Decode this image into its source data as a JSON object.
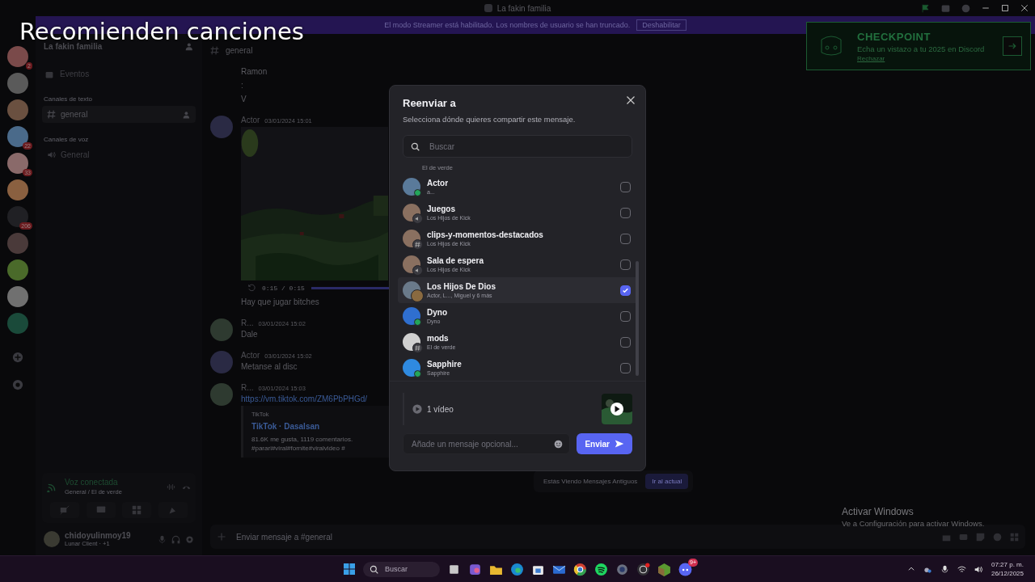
{
  "caption": "Recomienden canciones",
  "window": {
    "title": "La fakin familia"
  },
  "streamer_banner": {
    "text": "El modo Streamer está habilitado. Los nombres de usuario se han truncado.",
    "button": "Deshabilitar"
  },
  "servers": [
    {
      "color": "#7a4a4a",
      "badge": "2"
    },
    {
      "color": "#5a5a5a"
    },
    {
      "color": "#6a5040"
    },
    {
      "color": "#4a6a8a",
      "badge": "22"
    },
    {
      "color": "#8a6a6a",
      "badge": "33"
    },
    {
      "color": "#8a6040"
    },
    {
      "color": "#202024",
      "badge": "206"
    },
    {
      "color": "#4a3a3a"
    },
    {
      "color": "#4a6a2a"
    },
    {
      "color": "#707070"
    },
    {
      "color": "#1a4a3a"
    }
  ],
  "sidebar": {
    "server_name": "La fakin familia",
    "events": "Eventos",
    "categories": [
      {
        "label": "Canales de texto",
        "channels": [
          {
            "kind": "text",
            "name": "general",
            "selected": true
          }
        ]
      },
      {
        "label": "Canales de voz",
        "channels": [
          {
            "kind": "voice",
            "name": "General",
            "selected": false
          }
        ]
      }
    ],
    "voice_panel": {
      "status": "Voz conectada",
      "location": "General / El de verde"
    },
    "user": {
      "name": "chidoyulinmoy19",
      "activity": "Lunar Client · +1"
    }
  },
  "chat": {
    "channel": "general",
    "messages": [
      {
        "kind": "line",
        "text": "Ramon"
      },
      {
        "kind": "line",
        "text": ":"
      },
      {
        "kind": "line",
        "text": "V"
      },
      {
        "kind": "message",
        "author": "Actor",
        "time": "03/01/2024 15:01",
        "attachment": {
          "kind": "video",
          "time": "0:15 / 0:15",
          "level": 1
        }
      },
      {
        "kind": "line",
        "text": "Hay que jugar bitches"
      },
      {
        "kind": "message",
        "author": "R...",
        "time": "03/01/2024 15:02",
        "text": "Dale"
      },
      {
        "kind": "message",
        "author": "Actor",
        "time": "03/01/2024 15:02",
        "text": "Metanse al disc"
      },
      {
        "kind": "message",
        "author": "R...",
        "time": "03/01/2024 15:03",
        "link": "https://vm.tiktok.com/ZM6PbPHGd/",
        "embed": {
          "provider": "TikTok",
          "title": "TikTok · Dasalsan",
          "description": "81.6K me gusta, 1119 comentarios. #parari#viral#fornite#viralvideo #"
        }
      }
    ],
    "old_messages": {
      "text": "Estás Viendo Mensajes Antiguos",
      "button": "Ir al actual"
    },
    "input": {
      "placeholder": "Enviar mensaje a #general"
    }
  },
  "checkpoint": {
    "title": "CHECKPOINT",
    "text": "Echa un vistazo a tu 2025 en Discord",
    "dismiss": "Rechazar"
  },
  "dialog": {
    "title": "Reenviar a",
    "subtitle": "Selecciona dónde quieres compartir este mensaje.",
    "search": {
      "placeholder": "Buscar"
    },
    "clipped_row": {
      "subtitle": "El de verde"
    },
    "rows": [
      {
        "kind": "user",
        "name": "Actor",
        "subtitle": "a...",
        "color": "#5a7a9a",
        "checked": false
      },
      {
        "kind": "voice",
        "name": "Juegos",
        "subtitle": "Los Hijos de Kick",
        "color": "#8a7060",
        "checked": false
      },
      {
        "kind": "text",
        "name": "clips-y-momentos-destacados",
        "subtitle": "Los Hijos de Kick",
        "color": "#8a7060",
        "checked": false
      },
      {
        "kind": "voice",
        "name": "Sala de espera",
        "subtitle": "Los Hijos de Kick",
        "color": "#8a7060",
        "checked": false
      },
      {
        "kind": "group",
        "name": "Los Hijos De Dios",
        "subtitle": "Actor, L..., Miguel y 6 más",
        "color": "#6a7a8a",
        "checked": true
      },
      {
        "kind": "user",
        "name": "Dyno",
        "subtitle": "Dyno",
        "color": "#2f6fd0",
        "checked": false
      },
      {
        "kind": "text",
        "name": "mods",
        "subtitle": "El de verde",
        "color": "#d0d0d0",
        "checked": false
      },
      {
        "kind": "bot",
        "name": "Sapphire",
        "subtitle": "Sapphire",
        "color": "#2f8ae0",
        "checked": false
      }
    ],
    "attachment": "1 vídeo",
    "message": {
      "placeholder": "Añade un mensaje opcional..."
    },
    "send": "Enviar"
  },
  "activation": {
    "title": "Activar Windows",
    "text": "Ve a Configuración para activar Windows."
  },
  "taskbar": {
    "search": "Buscar",
    "app_badge": "9+",
    "time": "07:27 p. m.",
    "date": "26/12/2025"
  }
}
